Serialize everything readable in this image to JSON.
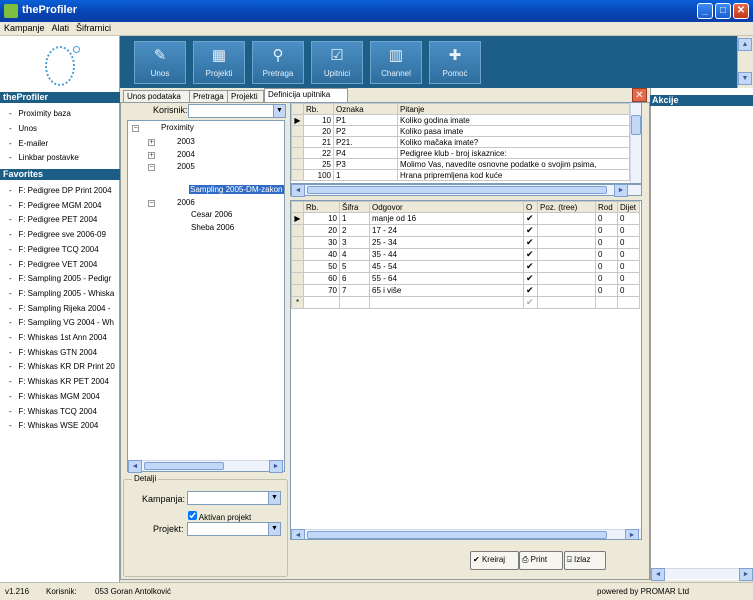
{
  "window": {
    "title": "theProfiler"
  },
  "menu": [
    "Kampanje",
    "Alati",
    "Šifrarnici"
  ],
  "left_panel": {
    "header": "theProfiler",
    "items": [
      "Proximity baza",
      "Unos",
      "E-mailer",
      "Linkbar postavke"
    ],
    "favorites_header": "Favorites",
    "favorites": [
      "F: Pedigree DP Print 2004",
      "F: Pedigree MGM 2004",
      "F: Pedigree PET 2004",
      "F: Pedigree sve 2006-09",
      "F: Pedigree TCQ 2004",
      "F: Pedigree VET 2004",
      "F: Sampling 2005 - Pedigr",
      "F: Sampling 2005 - Whiska",
      "F: Sampling Rijeka 2004 -",
      "F: Sampling VG 2004 - Wh",
      "F: Whiskas 1st Ann 2004",
      "F: Whiskas GTN 2004",
      "F: Whiskas KR DR Print 20",
      "F: Whiskas KR PET 2004",
      "F: Whiskas MGM 2004",
      "F: Whiskas TCQ 2004",
      "F: Whiskas WSE 2004"
    ]
  },
  "toolbar": [
    "Unos",
    "Projekti",
    "Pretraga",
    "Upitnici",
    "Channel",
    "Pomoć"
  ],
  "tabs": [
    "Unos podataka",
    "Pretraga",
    "Projekti",
    "Definicija upitnika"
  ],
  "korisnik_label": "Korisnik:",
  "tree": {
    "root": "Proximity",
    "y2003": "2003",
    "y2004": "2004",
    "y2005": "2005",
    "selected": "Sampling 2005-DM-zakon",
    "y2006": "2006",
    "c2006a": "Cesar 2006",
    "c2006b": "Sheba 2006"
  },
  "detalji": {
    "title": "Detalji",
    "kampanja_label": "Kampanja:",
    "aktivan_label": "Aktivan projekt",
    "projekt_label": "Projekt:"
  },
  "questions": {
    "headers": [
      "Rb.",
      "Oznaka",
      "Pitanje"
    ],
    "rows": [
      [
        "10",
        "P1",
        "Koliko godina imate"
      ],
      [
        "20",
        "P2",
        "Koliko pasa imate"
      ],
      [
        "21",
        "P21.",
        "Koliko mačaka imate?"
      ],
      [
        "22",
        "P4",
        "Pedigree klub - broj iskaznice:"
      ],
      [
        "25",
        "P3",
        "Molimo Vas, navedite osnovne podatke o svojim psima,"
      ],
      [
        "100",
        "1",
        "Hrana pripremljena kod kuće"
      ]
    ]
  },
  "answers": {
    "headers": [
      "Rb.",
      "Šifra",
      "Odgovor",
      "O",
      "Poz. (tree)",
      "Rod",
      "Dijet"
    ],
    "rows": [
      [
        "10",
        "1",
        "manje od 16",
        "✔",
        "",
        "0",
        "0"
      ],
      [
        "20",
        "2",
        "17 - 24",
        "✔",
        "",
        "0",
        "0"
      ],
      [
        "30",
        "3",
        "25 - 34",
        "✔",
        "",
        "0",
        "0"
      ],
      [
        "40",
        "4",
        "35 - 44",
        "✔",
        "",
        "0",
        "0"
      ],
      [
        "50",
        "5",
        "45 - 54",
        "✔",
        "",
        "0",
        "0"
      ],
      [
        "60",
        "6",
        "55 - 64",
        "✔",
        "",
        "0",
        "0"
      ],
      [
        "70",
        "7",
        "65 i više",
        "✔",
        "",
        "0",
        "0"
      ]
    ]
  },
  "actions": {
    "kreiraj": "Kreiraj",
    "print": "Print",
    "izlaz": "Izlaz"
  },
  "akcije": "Akcije",
  "status": {
    "version": "v1.216",
    "korisnik_label": "Korisnik:",
    "user": "053 Goran Antolković",
    "powered": "powered by PROMAR Ltd"
  }
}
